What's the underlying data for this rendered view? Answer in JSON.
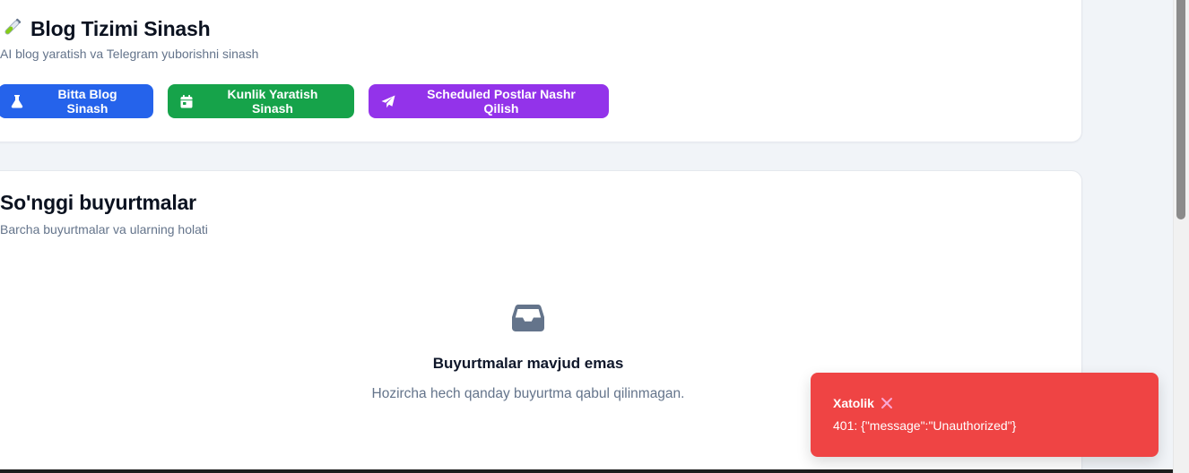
{
  "test_panel": {
    "emoji": "test-tube",
    "title": "Blog Tizimi Sinash",
    "subtitle": "AI blog yaratish va Telegram yuborishni sinash",
    "buttons": [
      {
        "label": "Bitta Blog Sinash",
        "icon": "flask-icon",
        "color": "#2563eb"
      },
      {
        "label": "Kunlik Yaratish Sinash",
        "icon": "calendar-icon",
        "color": "#16a34a"
      },
      {
        "label": "Scheduled Postlar Nashr Qilish",
        "icon": "paper-plane-icon",
        "color": "#9333ea"
      }
    ]
  },
  "orders": {
    "title": "So'nggi buyurtmalar",
    "subtitle": "Barcha buyurtmalar va ularning holati",
    "empty_icon": "inbox-icon",
    "empty_title": "Buyurtmalar mavjud emas",
    "empty_desc": "Hozircha hech qanday buyurtma qabul qilinmagan."
  },
  "toast": {
    "title": "Xatolik",
    "icon": "close-icon",
    "message": "401: {\"message\":\"Unauthorized\"}",
    "color": "#ef4444"
  }
}
